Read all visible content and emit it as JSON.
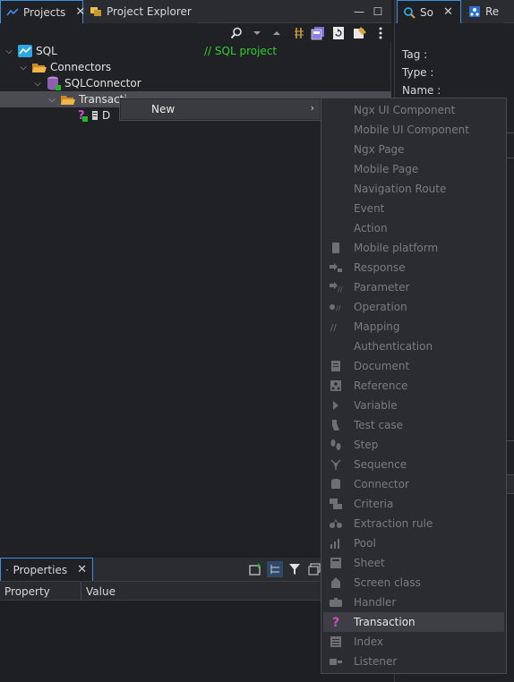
{
  "projects_panel": {
    "tabs": [
      {
        "label": "Projects",
        "close": "✕"
      },
      {
        "label": "Project Explorer"
      }
    ],
    "window_controls": {
      "minimize": "—",
      "maximize": "☐"
    },
    "tree": [
      {
        "label": "SQL",
        "comment": "// SQL project"
      },
      {
        "label": "Connectors"
      },
      {
        "label": "SQLConnector"
      },
      {
        "label": "Transacti"
      },
      {
        "label": "D"
      }
    ]
  },
  "right_panel": {
    "tabs": [
      {
        "label": "So",
        "close": "✕"
      },
      {
        "label": "Re"
      }
    ],
    "fields": [
      {
        "label": "Tag :"
      },
      {
        "label": "Type :"
      },
      {
        "label": "Name :"
      }
    ]
  },
  "properties_panel": {
    "tab": {
      "label": "Properties",
      "close": "✕"
    },
    "columns": [
      "Property",
      "Value"
    ]
  },
  "context_menu": {
    "new_label": "New",
    "arrow": "›",
    "submenu": [
      {
        "label": "Ngx UI Component",
        "enabled": false,
        "icon": "none"
      },
      {
        "label": "Mobile UI Component",
        "enabled": false,
        "icon": "none"
      },
      {
        "label": "Ngx Page",
        "enabled": false,
        "icon": "none"
      },
      {
        "label": "Mobile Page",
        "enabled": false,
        "icon": "none"
      },
      {
        "label": "Navigation Route",
        "enabled": false,
        "icon": "none"
      },
      {
        "label": "Event",
        "enabled": false,
        "icon": "none"
      },
      {
        "label": "Action",
        "enabled": false,
        "icon": "none"
      },
      {
        "label": "Mobile platform",
        "enabled": false,
        "icon": "mobile-platform-icon"
      },
      {
        "label": "Response",
        "enabled": false,
        "icon": "response-icon"
      },
      {
        "label": "Parameter",
        "enabled": false,
        "icon": "parameter-icon"
      },
      {
        "label": "Operation",
        "enabled": false,
        "icon": "operation-icon"
      },
      {
        "label": "Mapping",
        "enabled": false,
        "icon": "mapping-icon"
      },
      {
        "label": "Authentication",
        "enabled": false,
        "icon": "none"
      },
      {
        "label": "Document",
        "enabled": false,
        "icon": "document-icon"
      },
      {
        "label": "Reference",
        "enabled": false,
        "icon": "reference-icon"
      },
      {
        "label": "Variable",
        "enabled": false,
        "icon": "variable-icon"
      },
      {
        "label": "Test case",
        "enabled": false,
        "icon": "test-case-icon"
      },
      {
        "label": "Step",
        "enabled": false,
        "icon": "step-icon"
      },
      {
        "label": "Sequence",
        "enabled": false,
        "icon": "sequence-icon"
      },
      {
        "label": "Connector",
        "enabled": false,
        "icon": "connector-icon"
      },
      {
        "label": "Criteria",
        "enabled": false,
        "icon": "criteria-icon"
      },
      {
        "label": "Extraction rule",
        "enabled": false,
        "icon": "extraction-rule-icon"
      },
      {
        "label": "Pool",
        "enabled": false,
        "icon": "pool-icon"
      },
      {
        "label": "Sheet",
        "enabled": false,
        "icon": "sheet-icon"
      },
      {
        "label": "Screen class",
        "enabled": false,
        "icon": "screen-class-icon"
      },
      {
        "label": "Handler",
        "enabled": false,
        "icon": "handler-icon"
      },
      {
        "label": "Transaction",
        "enabled": true,
        "icon": "transaction-icon"
      },
      {
        "label": "Index",
        "enabled": false,
        "icon": "index-icon"
      },
      {
        "label": "Listener",
        "enabled": false,
        "icon": "listener-icon"
      }
    ]
  },
  "colors": {
    "accent": "#3a8ee6",
    "comment": "#33cc33",
    "transaction_icon": "#d24ad2",
    "folder": "#e8a83b",
    "status_green": "#23b823"
  }
}
